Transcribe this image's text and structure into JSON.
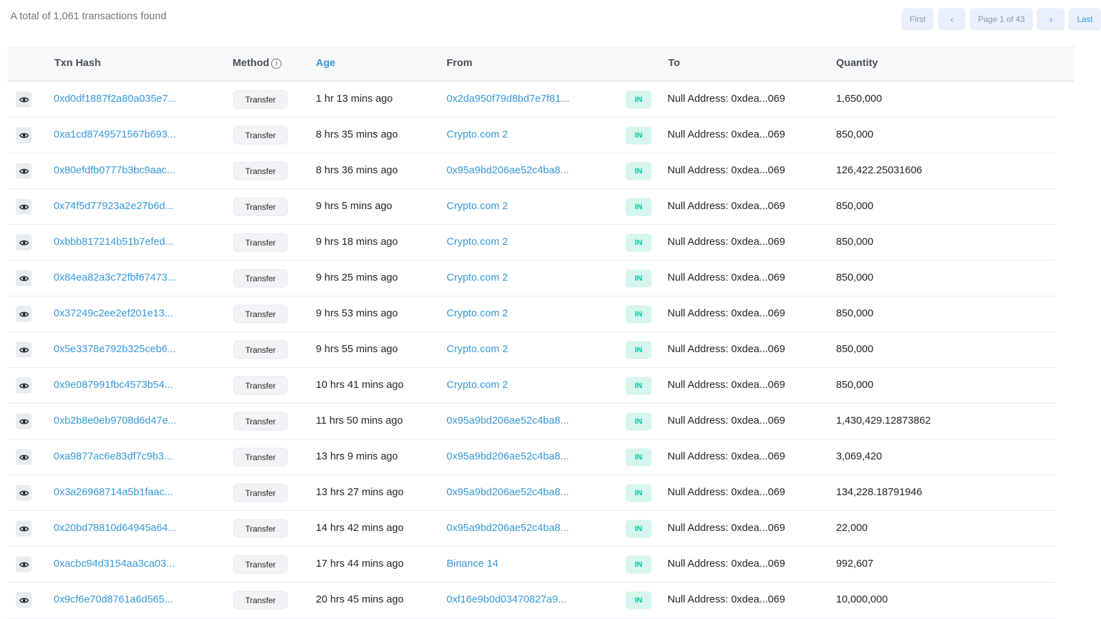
{
  "summary": "A total of 1,061 transactions found",
  "pagination": {
    "first": "First",
    "prev_icon": "chevron-left-icon",
    "page_label": "Page 1 of 43",
    "next_icon": "chevron-right-icon",
    "last": "Last"
  },
  "table": {
    "headers": {
      "hash": "Txn Hash",
      "method": "Method",
      "age": "Age",
      "from": "From",
      "to": "To",
      "quantity": "Quantity"
    },
    "rows": [
      {
        "hash": "0xd0df1887f2a80a035e7...",
        "method": "Transfer",
        "age": "1 hr 13 mins ago",
        "from": "0x2da950f79d8bd7e7f81...",
        "direction": "IN",
        "to": "Null Address: 0xdea...069",
        "quantity": "1,650,000"
      },
      {
        "hash": "0xa1cd8749571567b693...",
        "method": "Transfer",
        "age": "8 hrs 35 mins ago",
        "from": "Crypto.com 2",
        "direction": "IN",
        "to": "Null Address: 0xdea...069",
        "quantity": "850,000"
      },
      {
        "hash": "0x80efdfb0777b3bc9aac...",
        "method": "Transfer",
        "age": "8 hrs 36 mins ago",
        "from": "0x95a9bd206ae52c4ba8...",
        "direction": "IN",
        "to": "Null Address: 0xdea...069",
        "quantity": "126,422.25031606"
      },
      {
        "hash": "0x74f5d77923a2e27b6d...",
        "method": "Transfer",
        "age": "9 hrs 5 mins ago",
        "from": "Crypto.com 2",
        "direction": "IN",
        "to": "Null Address: 0xdea...069",
        "quantity": "850,000"
      },
      {
        "hash": "0xbbb817214b51b7efed...",
        "method": "Transfer",
        "age": "9 hrs 18 mins ago",
        "from": "Crypto.com 2",
        "direction": "IN",
        "to": "Null Address: 0xdea...069",
        "quantity": "850,000"
      },
      {
        "hash": "0x84ea82a3c72fbf67473...",
        "method": "Transfer",
        "age": "9 hrs 25 mins ago",
        "from": "Crypto.com 2",
        "direction": "IN",
        "to": "Null Address: 0xdea...069",
        "quantity": "850,000"
      },
      {
        "hash": "0x37249c2ee2ef201e13...",
        "method": "Transfer",
        "age": "9 hrs 53 mins ago",
        "from": "Crypto.com 2",
        "direction": "IN",
        "to": "Null Address: 0xdea...069",
        "quantity": "850,000"
      },
      {
        "hash": "0x5e3378e792b325ceb6...",
        "method": "Transfer",
        "age": "9 hrs 55 mins ago",
        "from": "Crypto.com 2",
        "direction": "IN",
        "to": "Null Address: 0xdea...069",
        "quantity": "850,000"
      },
      {
        "hash": "0x9e087991fbc4573b54...",
        "method": "Transfer",
        "age": "10 hrs 41 mins ago",
        "from": "Crypto.com 2",
        "direction": "IN",
        "to": "Null Address: 0xdea...069",
        "quantity": "850,000"
      },
      {
        "hash": "0xb2b8e0eb9708d6d47e...",
        "method": "Transfer",
        "age": "11 hrs 50 mins ago",
        "from": "0x95a9bd206ae52c4ba8...",
        "direction": "IN",
        "to": "Null Address: 0xdea...069",
        "quantity": "1,430,429.12873862"
      },
      {
        "hash": "0xa9877ac6e83df7c9b3...",
        "method": "Transfer",
        "age": "13 hrs 9 mins ago",
        "from": "0x95a9bd206ae52c4ba8...",
        "direction": "IN",
        "to": "Null Address: 0xdea...069",
        "quantity": "3,069,420"
      },
      {
        "hash": "0x3a26968714a5b1faac...",
        "method": "Transfer",
        "age": "13 hrs 27 mins ago",
        "from": "0x95a9bd206ae52c4ba8...",
        "direction": "IN",
        "to": "Null Address: 0xdea...069",
        "quantity": "134,228.18791946"
      },
      {
        "hash": "0x20bd78810d64945a64...",
        "method": "Transfer",
        "age": "14 hrs 42 mins ago",
        "from": "0x95a9bd206ae52c4ba8...",
        "direction": "IN",
        "to": "Null Address: 0xdea...069",
        "quantity": "22,000"
      },
      {
        "hash": "0xacbc94d3154aa3ca03...",
        "method": "Transfer",
        "age": "17 hrs 44 mins ago",
        "from": "Binance 14",
        "direction": "IN",
        "to": "Null Address: 0xdea...069",
        "quantity": "992,607"
      },
      {
        "hash": "0x9cf6e70d8761a6d565...",
        "method": "Transfer",
        "age": "20 hrs 45 mins ago",
        "from": "0xf16e9b0d03470827a9...",
        "direction": "IN",
        "to": "Null Address: 0xdea...069",
        "quantity": "10,000,000"
      }
    ]
  },
  "colors": {
    "link": "#3498db",
    "in_badge_bg": "#d6f5ec",
    "in_badge_text": "#00c9a7",
    "pager_bg": "#e9f0fb"
  },
  "icons": {
    "row_preview": "eye-icon",
    "method_info": "info-icon"
  }
}
